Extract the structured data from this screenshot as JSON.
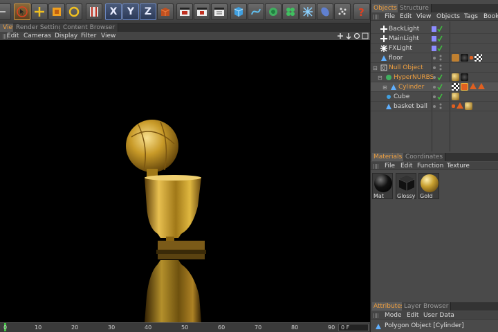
{
  "toolbar": {
    "icons": [
      "undo-icon",
      "select-arrow-icon",
      "move-icon",
      "scale-icon",
      "rotate-icon",
      "film-clapper-icon",
      "x-axis",
      "y-axis",
      "z-axis",
      "world-coord-icon",
      "render-view-icon",
      "render-region-icon",
      "render-picture-viewer-icon",
      "cube-primitive-icon",
      "spline-icon",
      "nurbs-icon",
      "array-icon",
      "deformer-icon",
      "environment-icon",
      "scene-icon",
      "camera-light-icon",
      "help-icon"
    ],
    "axes": [
      "X",
      "Y",
      "Z"
    ]
  },
  "view_tabs": [
    "View",
    "Render Settings",
    "Content Browser"
  ],
  "view_menu": [
    "Edit",
    "Cameras",
    "Display",
    "Filter",
    "View"
  ],
  "timeline": {
    "ticks": [
      "0",
      "10",
      "20",
      "30",
      "40",
      "50",
      "60",
      "70",
      "80",
      "90"
    ],
    "frame_value": "0 F"
  },
  "objects_panel": {
    "tabs": [
      "Objects",
      "Structure"
    ],
    "menu": [
      "File",
      "Edit",
      "View",
      "Objects",
      "Tags",
      "Bookm"
    ],
    "items": [
      {
        "name": "BackLight",
        "icon": "light-icon",
        "highlight": false
      },
      {
        "name": "MainLight",
        "icon": "light-icon",
        "highlight": false
      },
      {
        "name": "FXLight",
        "icon": "light-icon",
        "highlight": false
      },
      {
        "name": "floor",
        "icon": "floor-icon",
        "highlight": false
      },
      {
        "name": "Null Object",
        "icon": "null-object-icon",
        "highlight": true
      },
      {
        "name": "HyperNURBS",
        "icon": "hypernurbs-icon",
        "highlight": true
      },
      {
        "name": "Cylinder",
        "icon": "polygon-icon",
        "highlight": true
      },
      {
        "name": "Cube",
        "icon": "cube-icon",
        "highlight": false
      },
      {
        "name": "basket ball",
        "icon": "polygon-icon",
        "highlight": false
      }
    ]
  },
  "materials_panel": {
    "tabs": [
      "Materials",
      "Coordinates"
    ],
    "menu": [
      "File",
      "Edit",
      "Function",
      "Texture"
    ],
    "materials": [
      {
        "name": "Mat",
        "color": "#111111"
      },
      {
        "name": "Glossy",
        "color": "#222222"
      },
      {
        "name": "Gold",
        "color": "#c8a030"
      }
    ]
  },
  "attributes_panel": {
    "tabs": [
      "Attributes",
      "Layer Browser"
    ],
    "menu": [
      "Mode",
      "Edit",
      "User Data"
    ],
    "title": "Polygon Object [Cylinder]"
  },
  "colors": {
    "accent": "#f0a040",
    "gold": "#c8a030",
    "check": "#40c040"
  }
}
